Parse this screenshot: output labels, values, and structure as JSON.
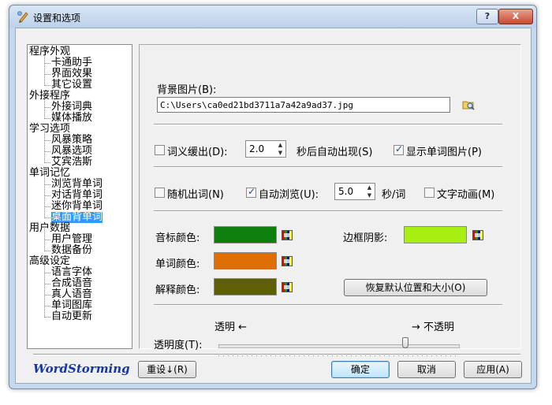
{
  "window": {
    "title": "设置和选项",
    "help_label": "?",
    "close_label": "X"
  },
  "tree": {
    "items": [
      {
        "label": "程序外观",
        "level": 0
      },
      {
        "label": "卡通助手",
        "level": 1
      },
      {
        "label": "界面效果",
        "level": 1
      },
      {
        "label": "其它设置",
        "level": 1
      },
      {
        "label": "外接程序",
        "level": 0
      },
      {
        "label": "外接词典",
        "level": 1
      },
      {
        "label": "媒体播放",
        "level": 1
      },
      {
        "label": "学习选项",
        "level": 0
      },
      {
        "label": "风暴策略",
        "level": 1
      },
      {
        "label": "风暴选项",
        "level": 1
      },
      {
        "label": "艾宾浩斯",
        "level": 1
      },
      {
        "label": "单词记忆",
        "level": 0
      },
      {
        "label": "浏览背单词",
        "level": 1
      },
      {
        "label": "对话背单词",
        "level": 1
      },
      {
        "label": "迷你背单词",
        "level": 1
      },
      {
        "label": "桌面背单词",
        "level": 1,
        "selected": true
      },
      {
        "label": "用户数据",
        "level": 0
      },
      {
        "label": "用户管理",
        "level": 1
      },
      {
        "label": "数据备份",
        "level": 1
      },
      {
        "label": "高级设定",
        "level": 0
      },
      {
        "label": "语言字体",
        "level": 1
      },
      {
        "label": "合成语音",
        "level": 1
      },
      {
        "label": "真人语音",
        "level": 1
      },
      {
        "label": "单词图库",
        "level": 1
      },
      {
        "label": "自动更新",
        "level": 1
      }
    ]
  },
  "panel": {
    "bg_image_label": "背景图片(B):",
    "bg_image_path": "C:\\Users\\ca0ed21bd3711a7a42a9ad37.jpg",
    "gradual_label": "词义缓出(D):",
    "gradual_value": "2.0",
    "gradual_suffix": "秒后自动出现(S)",
    "show_image_label": "显示单词图片(P)",
    "random_label": "随机出词(N)",
    "auto_browse_label": "自动浏览(U):",
    "auto_browse_value": "5.0",
    "auto_browse_suffix": "秒/词",
    "text_anim_label": "文字动画(M)",
    "phonetic_color_label": "音标颜色:",
    "word_color_label": "单词颜色:",
    "explain_color_label": "解释颜色:",
    "border_shadow_label": "边框阴影:",
    "restore_button": "恢复默认位置和大小(O)",
    "transparent_label": "透明 ←",
    "opaque_label": "→ 不透明",
    "opacity_label": "透明度(T):",
    "opacity_value": 0.78
  },
  "colors": {
    "phonetic": "#0d7f0d",
    "word": "#de6f06",
    "explain": "#5f5f05",
    "border_shadow": "#a8ee10",
    "selection": "#3399ff"
  },
  "checkboxes": {
    "gradual": false,
    "show_image": true,
    "random": false,
    "auto_browse": true,
    "text_anim": false
  },
  "footer": {
    "brand": "WordStorming",
    "reset_button": "重设↓(R)",
    "ok_button": "确定",
    "cancel_button": "取消",
    "apply_button": "应用(A)"
  },
  "icons": {
    "title": "pencil-settings-icon",
    "browse": "folder-browse-icon",
    "picker": "color-picker-icon"
  }
}
